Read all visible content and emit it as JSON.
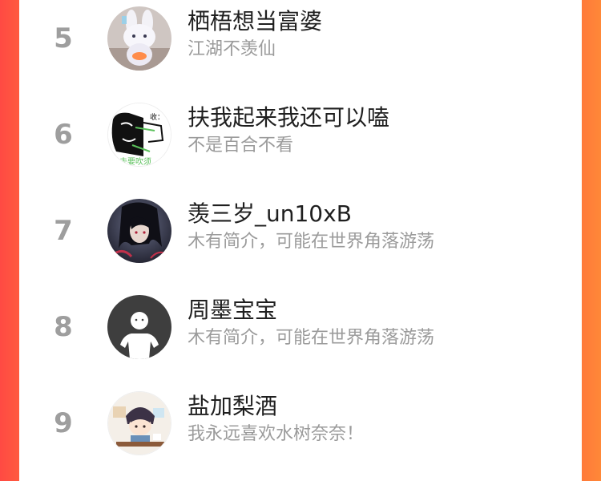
{
  "rankings": [
    {
      "rank": "5",
      "name": "栖梧想当富婆",
      "desc": "江湖不羡仙"
    },
    {
      "rank": "6",
      "name": "扶我起来我还可以嗑",
      "desc": "不是百合不看"
    },
    {
      "rank": "7",
      "name": "羡三岁_un10xB",
      "desc": "木有简介，可能在世界角落游荡"
    },
    {
      "rank": "8",
      "name": "周墨宝宝",
      "desc": "木有简介，可能在世界角落游荡"
    },
    {
      "rank": "9",
      "name": "盐加梨酒",
      "desc": "我永远喜欢水树奈奈！"
    }
  ],
  "avatar_text": {
    "row6_top": "收：",
    "row6_bottom": "去要吹须"
  },
  "colors": {
    "accent_left": "#ff4a43",
    "accent_right": "#ff8838",
    "rank_gray": "#9e9e9e",
    "name_dark": "#1f1f1f",
    "desc_gray": "#9b9b9b"
  }
}
